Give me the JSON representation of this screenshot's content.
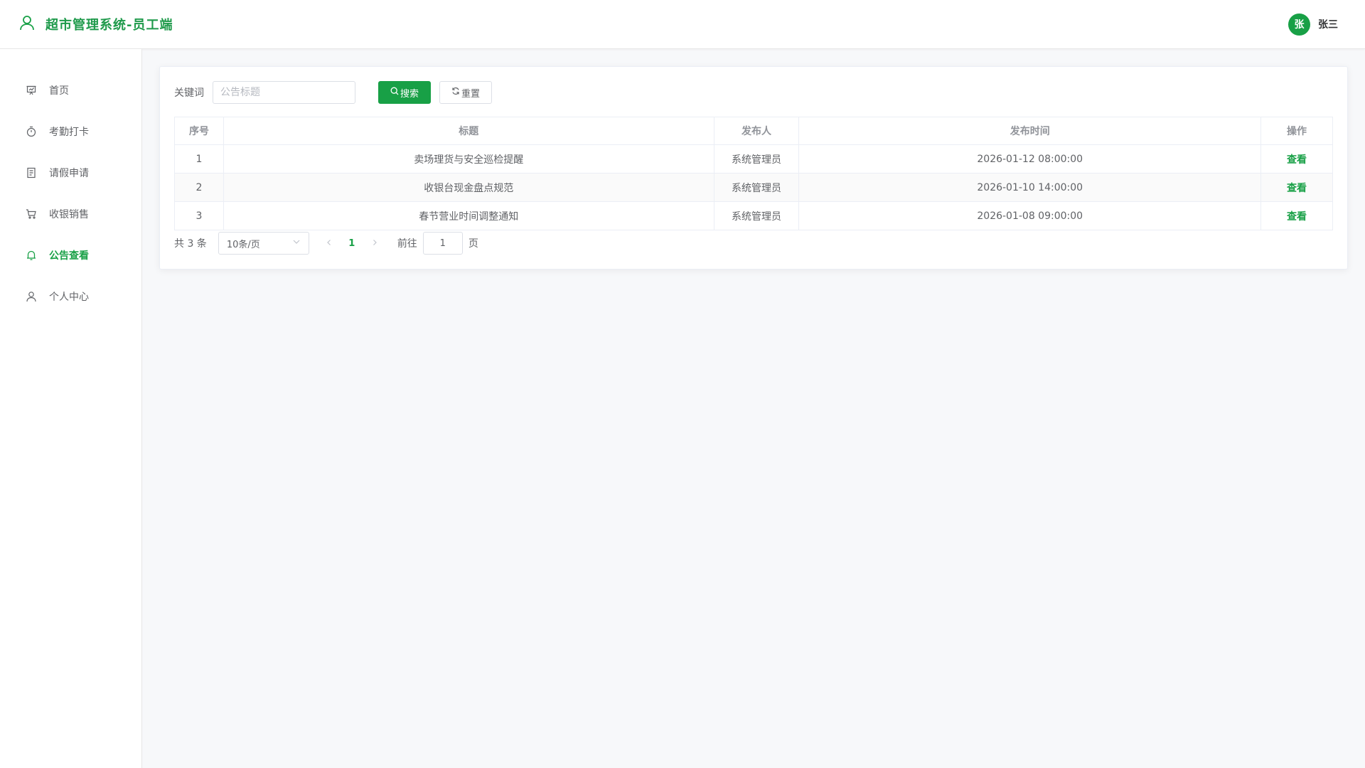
{
  "header": {
    "title": "超市管理系统-员工端",
    "avatar_text": "张",
    "username": "张三",
    "brand_icon": "user-outline-icon",
    "accent_color": "#18a046"
  },
  "sidebar": {
    "items": [
      {
        "label": "首页",
        "icon": "presentation-icon",
        "active": false
      },
      {
        "label": "考勤打卡",
        "icon": "timer-icon",
        "active": false
      },
      {
        "label": "请假申请",
        "icon": "document-icon",
        "active": false
      },
      {
        "label": "收银销售",
        "icon": "shopping-cart-icon",
        "active": false
      },
      {
        "label": "公告查看",
        "icon": "bell-icon",
        "active": true
      },
      {
        "label": "个人中心",
        "icon": "user-icon",
        "active": false
      }
    ]
  },
  "search": {
    "label": "关键词",
    "placeholder": "公告标题",
    "value": "",
    "search_label": "搜索",
    "reset_label": "重置"
  },
  "table": {
    "headers": [
      "序号",
      "标题",
      "发布人",
      "发布时间",
      "操作"
    ],
    "rows": [
      {
        "idx": "1",
        "title": "卖场理货与安全巡检提醒",
        "publisher": "系统管理员",
        "time": "2026-01-12 08:00:00",
        "action": "查看"
      },
      {
        "idx": "2",
        "title": "收银台现金盘点规范",
        "publisher": "系统管理员",
        "time": "2026-01-10 14:00:00",
        "action": "查看"
      },
      {
        "idx": "3",
        "title": "春节营业时间调整通知",
        "publisher": "系统管理员",
        "time": "2026-01-08 09:00:00",
        "action": "查看"
      }
    ]
  },
  "pagination": {
    "total_text": "共 3 条",
    "page_size": "10条/页",
    "current_page": "1",
    "goto_label": "前往",
    "goto_value": "1",
    "unit_label": "页"
  }
}
